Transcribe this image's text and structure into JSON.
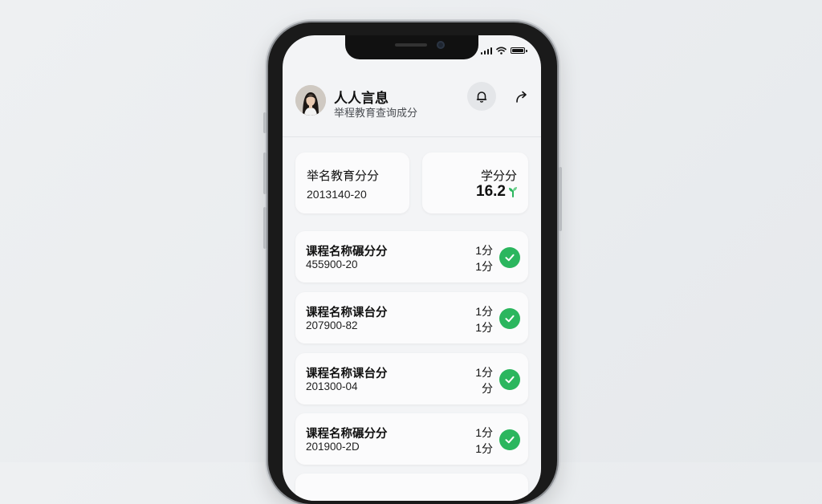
{
  "header": {
    "name": "人人言息",
    "subtitle": "举程教育查询成分"
  },
  "summary": {
    "title": "举名教育分分",
    "date": "2013140-20"
  },
  "credit": {
    "label": "学分分",
    "value": "16.2"
  },
  "courses": [
    {
      "name": "课程名称碾分分",
      "code": "455900-20",
      "credit_top": "1分",
      "credit_bottom": "1分"
    },
    {
      "name": "课程名称课台分",
      "code": "207900-82",
      "credit_top": "1分",
      "credit_bottom": "1分"
    },
    {
      "name": "课程名称课台分",
      "code": "201300-04",
      "credit_top": "1分",
      "credit_bottom": "分"
    },
    {
      "name": "课程名称碾分分",
      "code": "201900-2D",
      "credit_top": "1分",
      "credit_bottom": "1分"
    }
  ],
  "colors": {
    "accent_green": "#2bb65e",
    "background": "#f3f4f6",
    "card": "#fbfbfc"
  },
  "icons": {
    "bell": "bell-icon",
    "share": "share-arrow-icon",
    "check": "check-icon",
    "credit": "sprout-icon"
  }
}
